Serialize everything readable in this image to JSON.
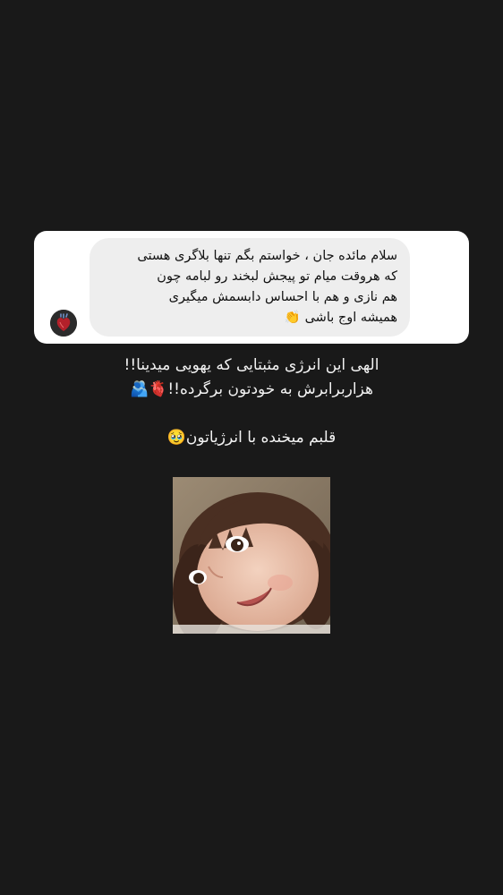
{
  "question_card": {
    "sender_avatar_icon": "anatomical-heart-icon",
    "message_lines": [
      "سلام مائده جان ، خواستم بگم تنها بلاگری هستی",
      "که هروقت میام تو پیجش لبخند رو لبامه چون",
      "هم نازی و هم با احساس دابسمش میگیری",
      "همیشه اوج باشی 👏"
    ]
  },
  "reply": {
    "line_1": "الهی این انرژی مثبتایی که یهویی میدینا!!",
    "line_2": "هزاربرابرش به خودتون برگرده!!🫀🫂",
    "line_3": "قلبم میخنده با انرژیاتون🥹"
  },
  "photo": {
    "subject_icon": "smiling-toddler-photo"
  },
  "colors": {
    "background": "#191919",
    "card": "#ffffff",
    "bubble": "#eeeeee",
    "text_light": "#f2f2f2"
  }
}
